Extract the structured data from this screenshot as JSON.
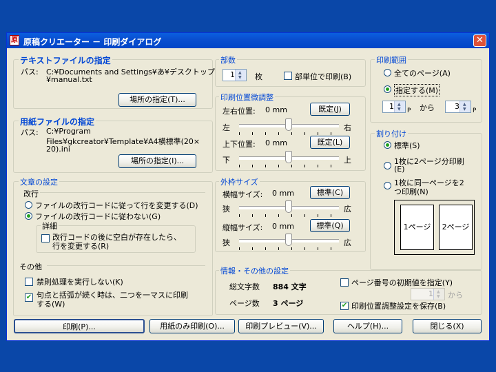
{
  "window": {
    "title": "原稿クリエーター － 印刷ダイアログ",
    "app_icon": "原"
  },
  "text_file": {
    "legend": "テキストファイルの指定",
    "path_label": "パス:",
    "path_line1": "C:¥Documents and Settings¥あ¥デスクトップ",
    "path_line2": "¥manual.txt",
    "browse_button": "場所の指定(T)..."
  },
  "paper_file": {
    "legend": "用紙ファイルの指定",
    "path_label": "パス:",
    "path_line1": "C:¥Program",
    "path_line2": "Files¥gkcreator¥Template¥A4横標準(20×",
    "path_line3": "20).ini",
    "browse_button": "場所の指定(I)..."
  },
  "text_settings": {
    "legend": "文章の設定",
    "newline_label": "改行",
    "opt_follow": "ファイルの改行コードに従って行を変更する(D)",
    "opt_ignore": "ファイルの改行コードに従わない(G)",
    "detail_legend": "詳細",
    "detail_line1": "改行コードの後に空白が存在したら、",
    "detail_line2": "行を変更する(R)",
    "other_label": "その他",
    "kinsoku": "禁則処理を実行しない(K)",
    "punct_line1": "句点と括弧が続く時は、二つを一マスに印刷",
    "punct_line2": "する(W)"
  },
  "copies": {
    "legend": "部数",
    "value": "1",
    "unit": "枚",
    "collate": "部単位で印刷(B)"
  },
  "position": {
    "legend": "印刷位置微調整",
    "h_label": "左右位置:",
    "h_value": "0 mm",
    "h_default": "既定(J)",
    "left": "左",
    "right": "右",
    "v_label": "上下位置:",
    "v_value": "0 mm",
    "v_default": "既定(L)",
    "down": "下",
    "up": "上"
  },
  "frame": {
    "legend": "外枠サイズ",
    "w_label": "横幅サイズ:",
    "w_value": "0 mm",
    "w_standard": "標準(C)",
    "narrow": "狭",
    "wide": "広",
    "h_label": "縦幅サイズ:",
    "h_value": "0 mm",
    "h_standard": "標準(Q)",
    "narrow2": "狭",
    "wide2": "広"
  },
  "range": {
    "legend": "印刷範囲",
    "all": "全てのページ(A)",
    "specify": "指定する(M)",
    "from": "1",
    "p1": "P",
    "kara": "から",
    "to": "3",
    "p2": "P"
  },
  "layout": {
    "legend": "割り付け",
    "standard": "標準(S)",
    "two_line1": "1枚に2ページ分印刷",
    "two_line2": "(E)",
    "same_line1": "1枚に同一ページを2",
    "same_line2": "つ印刷(N)",
    "preview_page1": "1ページ",
    "preview_page2": "2ページ"
  },
  "info": {
    "legend": "情報・その他の設定",
    "chars_label": "総文字数",
    "chars_value": "884 文字",
    "pages_label": "ページ数",
    "pages_value": "3 ページ",
    "start_page": "ページ番号の初期値を指定(Y)",
    "start_value": "1",
    "start_kara": "から",
    "save_pos": "印刷位置調整設定を保存(B)"
  },
  "buttons": {
    "print": "印刷(P)...",
    "paper_only": "用紙のみ印刷(O)...",
    "preview": "印刷プレビュー(V)...",
    "help": "ヘルプ(H)...",
    "close": "閉じる(X)"
  }
}
